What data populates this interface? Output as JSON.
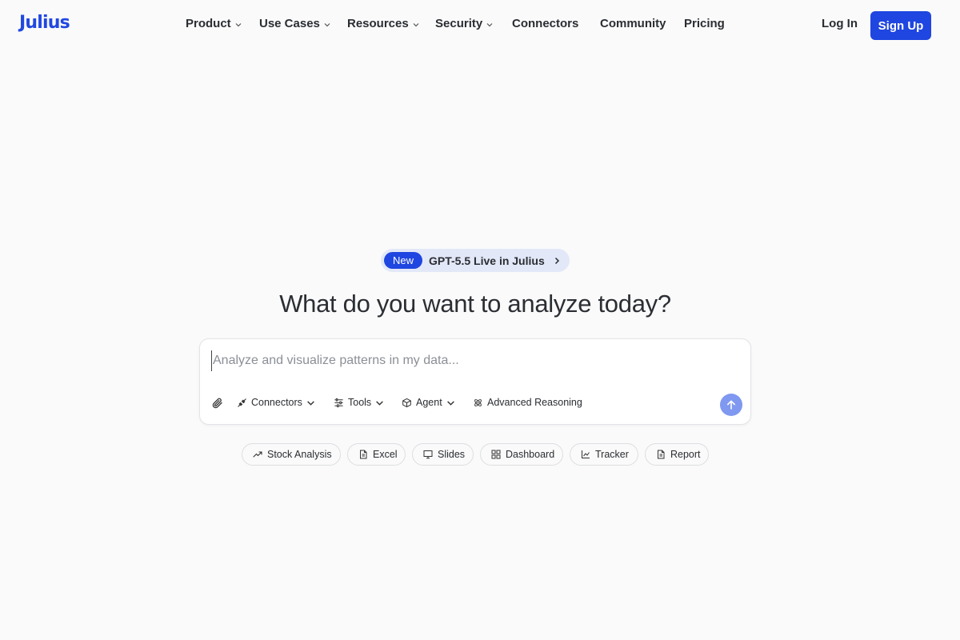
{
  "brand": {
    "name": "Julius",
    "color": "#2148e0"
  },
  "nav": [
    {
      "label": "Product",
      "dropdown": true
    },
    {
      "label": "Use Cases",
      "dropdown": true
    },
    {
      "label": "Resources",
      "dropdown": true
    },
    {
      "label": "Security",
      "dropdown": true
    },
    {
      "label": "Connectors",
      "dropdown": false
    },
    {
      "label": "Community",
      "dropdown": false
    },
    {
      "label": "Pricing",
      "dropdown": false
    }
  ],
  "auth": {
    "login_label": "Log In",
    "signup_label": "Sign Up",
    "accent": "#1f46e0"
  },
  "announcement": {
    "badge": "New",
    "text": "GPT-5.5 Live in Julius"
  },
  "headline": "What do you want to analyze today?",
  "prompt": {
    "value": "",
    "placeholder": "Analyze and visualize patterns in my data...",
    "attach_icon": "paperclip-icon",
    "tools": [
      {
        "label": "Connectors",
        "icon": "plug-icon",
        "dropdown": true
      },
      {
        "label": "Tools",
        "icon": "sliders-icon",
        "dropdown": true
      },
      {
        "label": "Agent",
        "icon": "cube-icon",
        "dropdown": true
      },
      {
        "label": "Advanced Reasoning",
        "icon": "atom-icon",
        "dropdown": false
      }
    ],
    "send_icon": "arrow-up-icon"
  },
  "suggestions": [
    {
      "label": "Stock Analysis",
      "icon": "trend-up-icon"
    },
    {
      "label": "Excel",
      "icon": "spreadsheet-icon"
    },
    {
      "label": "Slides",
      "icon": "presentation-icon"
    },
    {
      "label": "Dashboard",
      "icon": "grid-icon"
    },
    {
      "label": "Tracker",
      "icon": "line-chart-icon"
    },
    {
      "label": "Report",
      "icon": "document-icon"
    }
  ]
}
